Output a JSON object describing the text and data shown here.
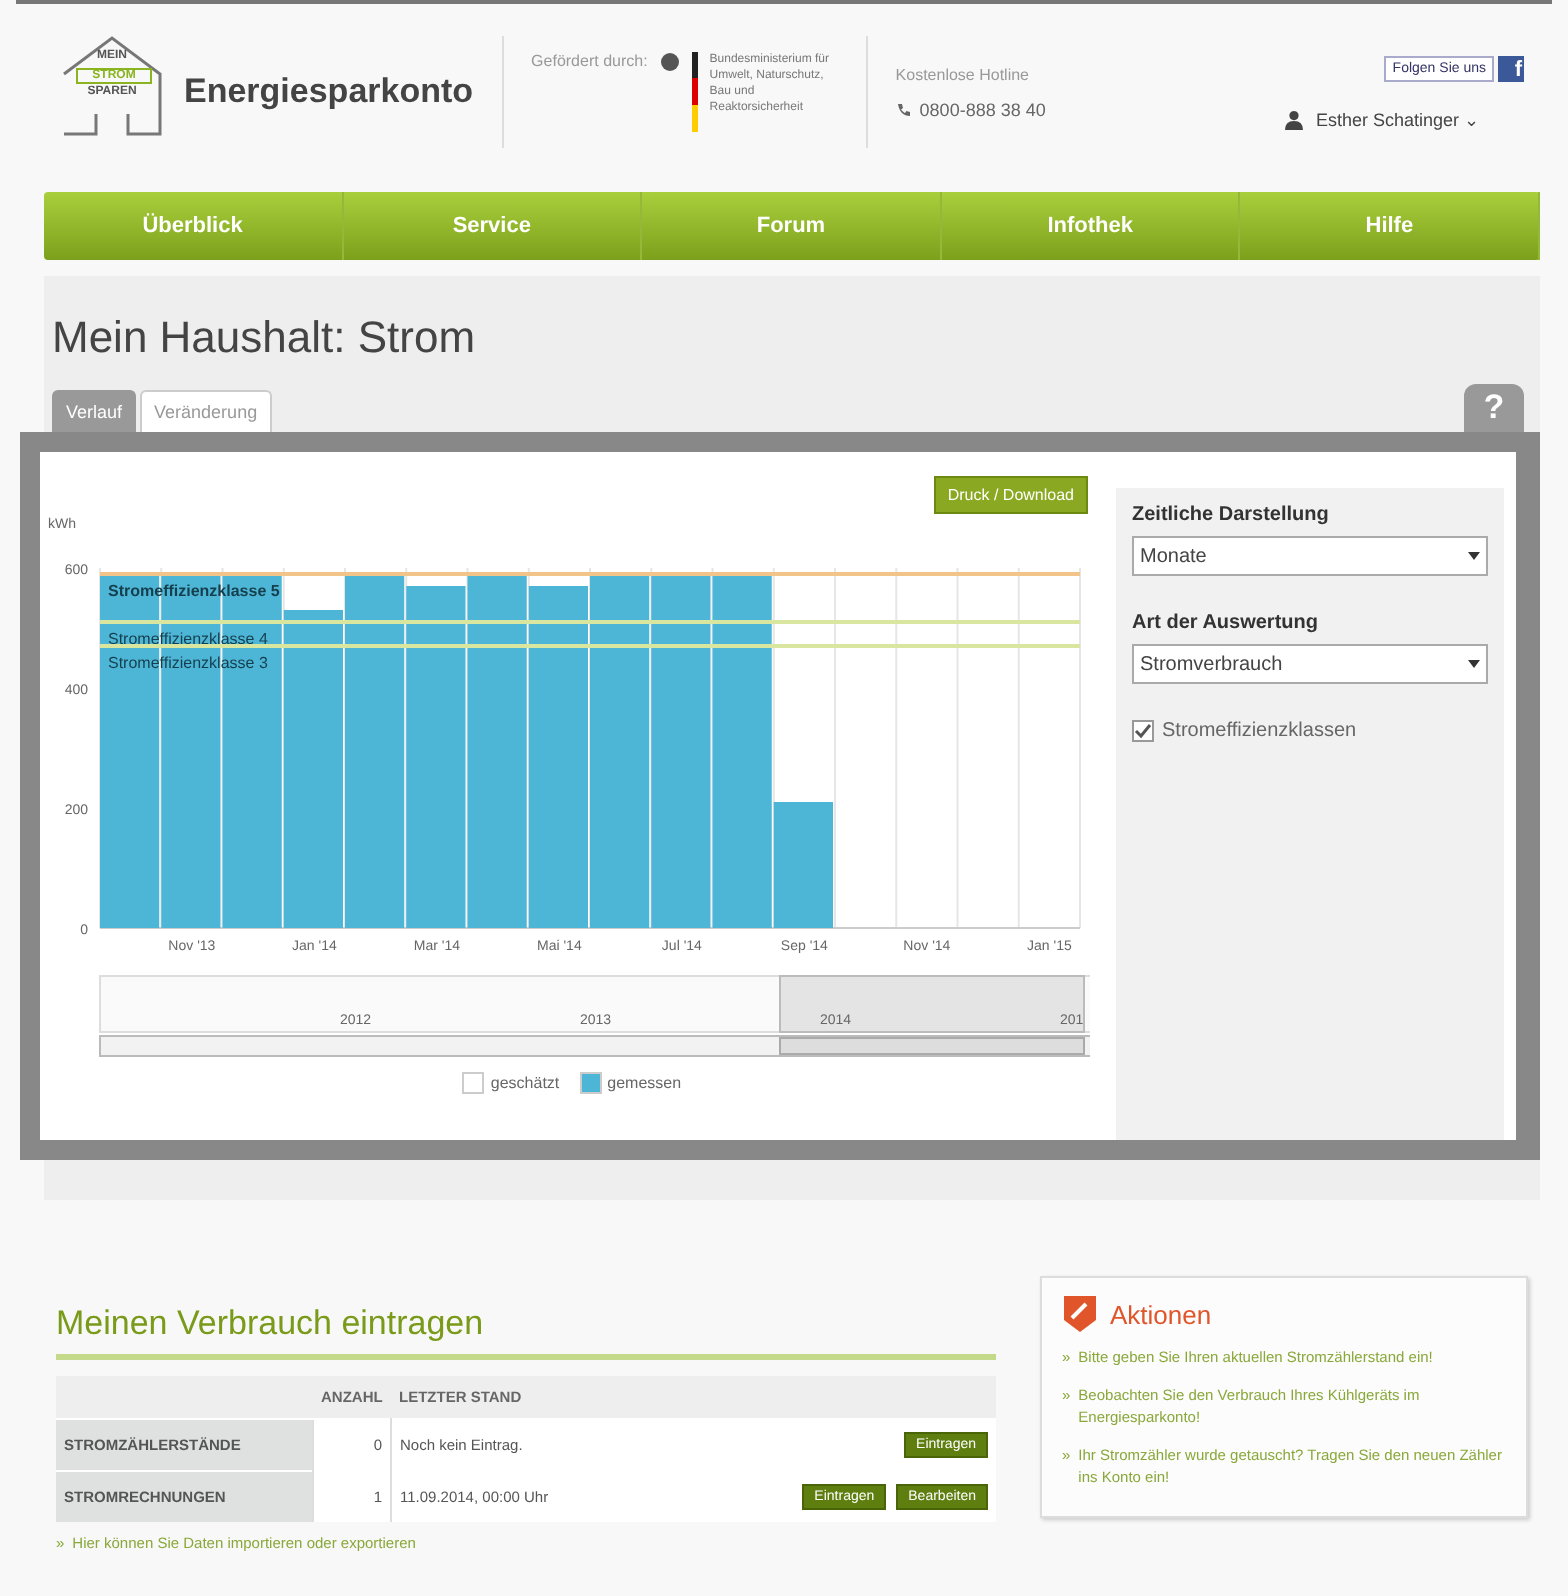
{
  "header": {
    "logo_lines": [
      "MEIN",
      "STROM",
      "SPAREN"
    ],
    "site_title": "Energiesparkonto",
    "sponsor_label": "Gefördert durch:",
    "ministry": "Bundesministerium für Umwelt, Naturschutz, Bau und Reaktorsicherheit",
    "hotline_label": "Kostenlose Hotline",
    "hotline": "0800-888 38 40",
    "follow": "Folgen Sie uns",
    "facebook": "f",
    "user": "Esther Schatinger",
    "user_caret": "⌄"
  },
  "nav": [
    {
      "label": "Überblick",
      "selected": false
    },
    {
      "label": "Service",
      "selected": false
    },
    {
      "label": "Forum",
      "selected": false
    },
    {
      "label": "Infothek",
      "selected": false
    },
    {
      "label": "Hilfe",
      "selected": false
    }
  ],
  "page_title": "Mein Haushalt: Strom",
  "tabs": [
    {
      "label": "Verlauf",
      "selected": true
    },
    {
      "label": "Veränderung",
      "selected": false
    }
  ],
  "help": "?",
  "chart": {
    "download": "Druck / Download",
    "chart_data": {
      "type": "bar",
      "ylabel": "kWh",
      "categories": [
        null,
        "Nov '13",
        null,
        "Jan '14",
        null,
        "Mar '14",
        null,
        "Mai '14",
        null,
        "Jul '14",
        null,
        "Sep '14",
        null,
        "Nov '14",
        null,
        "Jan '15"
      ],
      "series": [
        {
          "name": "geschätzt",
          "color": "#ffffff",
          "values": [
            null,
            null,
            null,
            null,
            null,
            null,
            null,
            null,
            null,
            null,
            null,
            null,
            null,
            null,
            null,
            null
          ]
        },
        {
          "name": "gemessen",
          "color": "#4db6d6",
          "values": [
            590,
            590,
            590,
            530,
            590,
            570,
            590,
            570,
            590,
            590,
            590,
            210,
            null,
            null,
            null,
            null
          ]
        }
      ],
      "stacked": true,
      "ylim": [
        0,
        600
      ],
      "yticks": [
        0,
        200,
        400,
        600
      ],
      "ref_lines": [
        {
          "axis": "y",
          "value": 590,
          "label": "Stromeffizienzklasse 5",
          "color": "#f2c48a"
        },
        {
          "axis": "y",
          "value": 510,
          "label": "Stromeffizienzklasse 4",
          "color": "#d8e6a0"
        },
        {
          "axis": "y",
          "value": 470,
          "label": "Stromeffizienzklasse 3",
          "color": "#d8e6a0"
        }
      ]
    },
    "navigator_years": [
      "2012",
      "2013",
      "2014",
      "201"
    ]
  },
  "settings": {
    "time_label": "Zeitliche Darstellung",
    "time_value": "Monate",
    "eval_label": "Art der Auswertung",
    "eval_value": "Stromverbrauch",
    "classes": {
      "label": "Stromeffizienzklassen",
      "checked": true
    }
  },
  "entries": {
    "title": "Meinen Verbrauch eintragen",
    "columns": [
      "ANZAHL",
      "LETZTER STAND"
    ],
    "rows": [
      {
        "name": "STROMZÄHLERSTÄNDE",
        "count": "0",
        "last": "Noch kein Eintrag.",
        "buttons": [
          "Eintragen"
        ]
      },
      {
        "name": "STROMRECHNUNGEN",
        "count": "1",
        "last": "11.09.2014, 00:00 Uhr",
        "buttons": [
          "Eintragen",
          "Bearbeiten"
        ]
      }
    ],
    "link": "Hier können Sie Daten importieren oder exportieren",
    "link_mark": "»"
  },
  "actions": {
    "title": "Aktionen",
    "mark": "»",
    "items": [
      "Bitte geben Sie Ihren aktuellen Stromzählerstand ein!",
      "Beobachten Sie den Verbrauch Ihres Kühlgeräts im Energiesparkonto!",
      "Ihr Stromzähler wurde getauscht? Tragen Sie den neuen Zähler ins Konto ein!"
    ]
  }
}
